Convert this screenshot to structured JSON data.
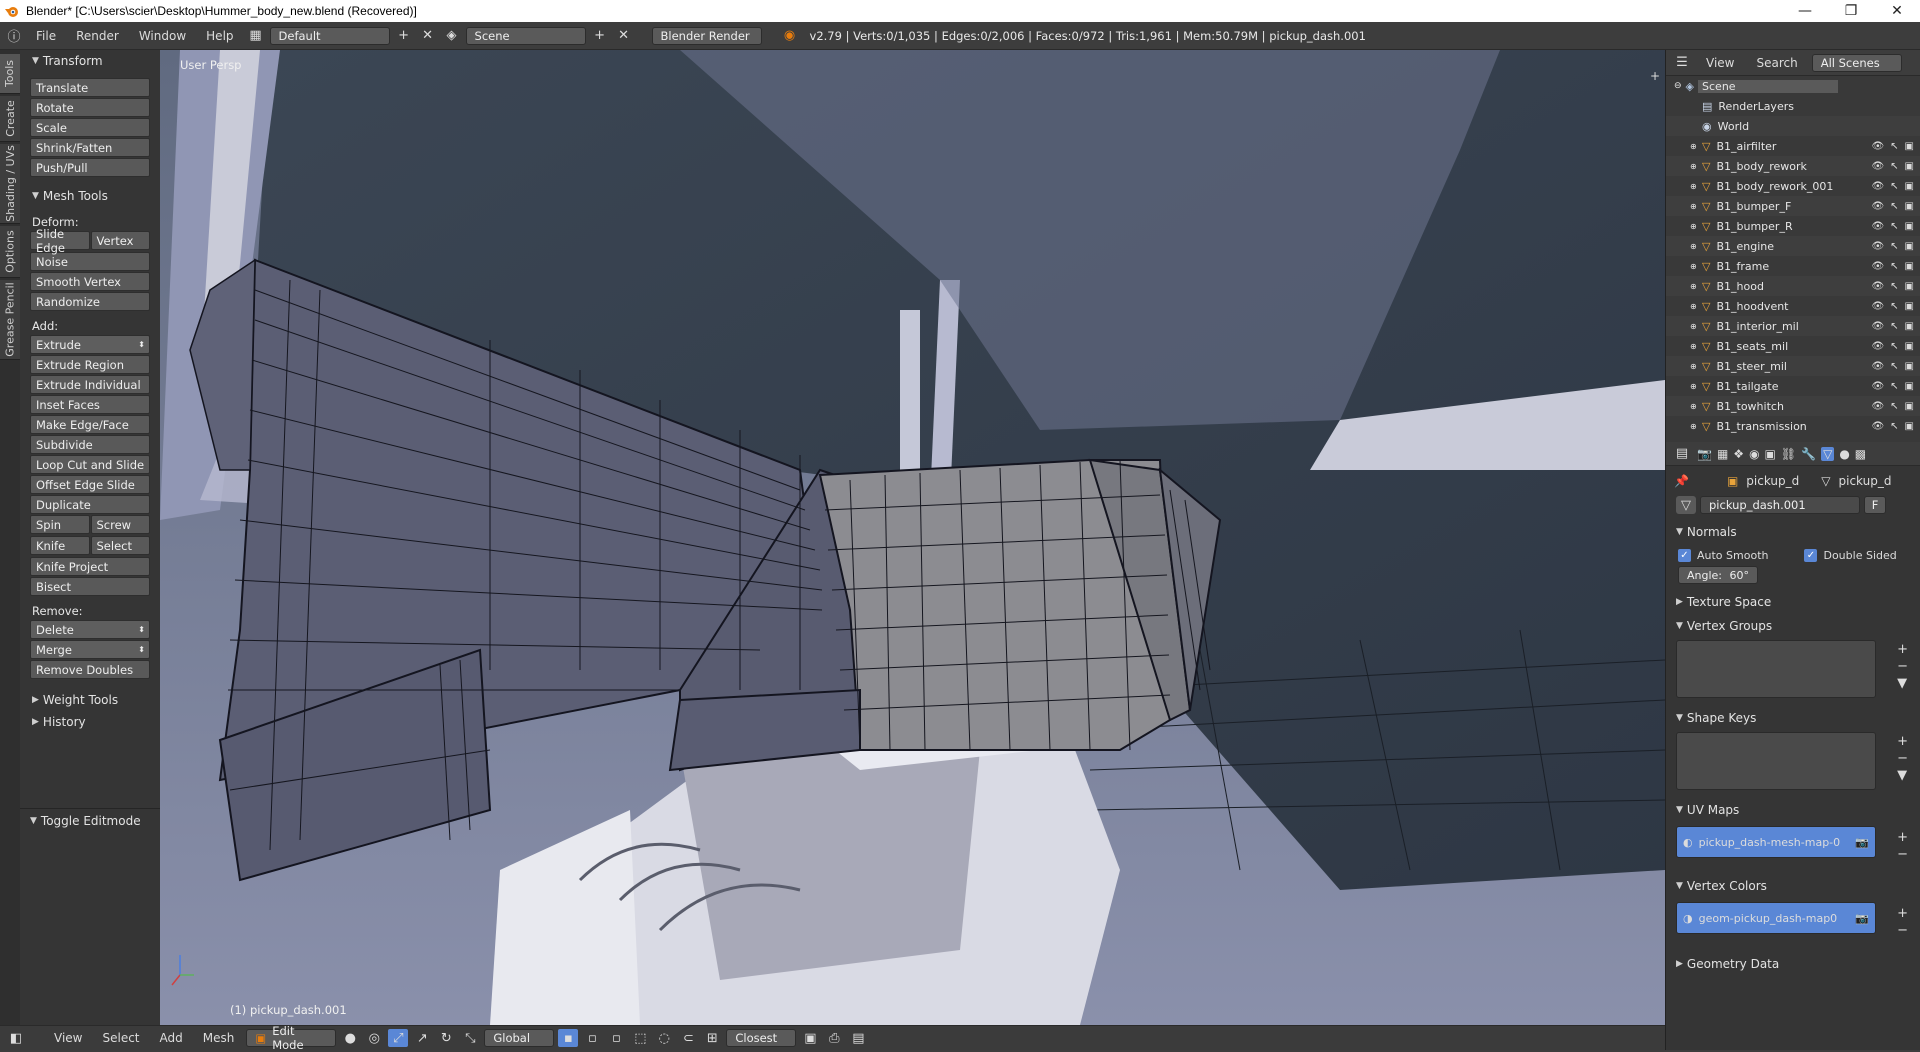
{
  "window": {
    "title": "Blender* [C:\\Users\\scier\\Desktop\\Hummer_body_new.blend (Recovered)]",
    "minimize": "—",
    "maximize": "❐",
    "close": "✕"
  },
  "topbar": {
    "menus": [
      "File",
      "Render",
      "Window",
      "Help"
    ],
    "layout": "Default",
    "scene": "Scene",
    "engine": "Blender Render",
    "stats": "v2.79 | Verts:0/1,035 | Edges:0/2,006 | Faces:0/972 | Tris:1,961 | Mem:50.79M | pickup_dash.001"
  },
  "tooltabs": [
    "Tools",
    "Create",
    "Shading / UVs",
    "Options",
    "Grease Pencil"
  ],
  "toolshelf": {
    "transform_header": "Transform",
    "transform": [
      "Translate",
      "Rotate",
      "Scale",
      "Shrink/Fatten",
      "Push/Pull"
    ],
    "mesh_tools_header": "Mesh Tools",
    "deform_label": "Deform:",
    "slide_edge": "Slide Edge",
    "vertex": "Vertex",
    "deform": [
      "Noise",
      "Smooth Vertex",
      "Randomize"
    ],
    "add_label": "Add:",
    "extrude": "Extrude",
    "add": [
      "Extrude Region",
      "Extrude Individual",
      "Inset Faces",
      "Make Edge/Face",
      "Subdivide",
      "Loop Cut and Slide",
      "Offset Edge Slide",
      "Duplicate"
    ],
    "spin": "Spin",
    "screw": "Screw",
    "knife": "Knife",
    "select": "Select",
    "knife_project": "Knife Project",
    "bisect": "Bisect",
    "remove_label": "Remove:",
    "delete": "Delete",
    "merge": "Merge",
    "remove_doubles": "Remove Doubles",
    "weight_tools": "Weight Tools",
    "history": "History",
    "toggle_editmode": "Toggle Editmode"
  },
  "viewport": {
    "view_label": "User Persp",
    "object_label": "(1) pickup_dash.001"
  },
  "bottombar": {
    "menus": [
      "View",
      "Select",
      "Add",
      "Mesh"
    ],
    "mode": "Edit Mode",
    "orientation": "Global",
    "snap": "Closest"
  },
  "outliner": {
    "header": [
      "View",
      "Search",
      "All Scenes"
    ],
    "scene": "Scene",
    "items": [
      "RenderLayers",
      "World",
      "B1_airfilter",
      "B1_body_rework",
      "B1_body_rework_001",
      "B1_bumper_F",
      "B1_bumper_R",
      "B1_engine",
      "B1_frame",
      "B1_hood",
      "B1_hoodvent",
      "B1_interior_mil",
      "B1_seats_mil",
      "B1_steer_mil",
      "B1_tailgate",
      "B1_towhitch",
      "B1_transmission"
    ]
  },
  "properties": {
    "context": [
      "pickup_d",
      "pickup_d"
    ],
    "mesh_name": "pickup_dash.001",
    "fake_user": "F",
    "normals": "Normals",
    "auto_smooth": "Auto Smooth",
    "double_sided": "Double Sided",
    "angle_label": "Angle:",
    "angle_value": "60°",
    "texture_space": "Texture Space",
    "vertex_groups": "Vertex Groups",
    "shape_keys": "Shape Keys",
    "uv_maps": "UV Maps",
    "uv_map_item": "pickup_dash-mesh-map-0",
    "vertex_colors": "Vertex Colors",
    "vertex_color_item": "geom-pickup_dash-map0",
    "geometry_data": "Geometry Data"
  },
  "colors": {
    "mesh_fill": "#5b5e74",
    "mesh_selected_face": "#8a8a8e",
    "background_grey": "#3d3d3d",
    "accent_blue": "#5a87d6"
  }
}
